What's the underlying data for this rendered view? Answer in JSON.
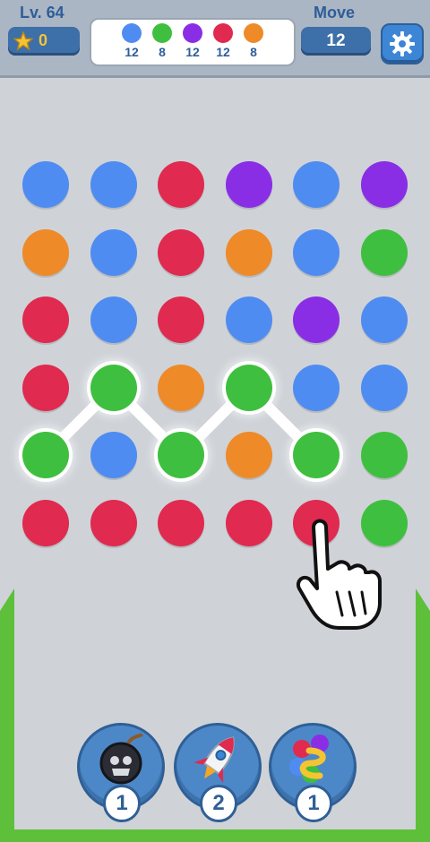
{
  "hud": {
    "level": "Lv. 64",
    "coins": "0",
    "move_label": "Move",
    "moves": "12",
    "goals": [
      {
        "color": "#4f8cf2",
        "count": "12"
      },
      {
        "color": "#3fbf3f",
        "count": "8"
      },
      {
        "color": "#8a2ee6",
        "count": "12"
      },
      {
        "color": "#e02a4f",
        "count": "12"
      },
      {
        "color": "#ef8a28",
        "count": "8"
      }
    ]
  },
  "colors": {
    "blue": "#4f8cf2",
    "red": "#e02a4f",
    "purple": "#8a2ee6",
    "orange": "#ef8a28",
    "green": "#3fbf3f"
  },
  "grid": [
    [
      "blue",
      "blue",
      "red",
      "purple",
      "blue",
      "purple"
    ],
    [
      "orange",
      "blue",
      "red",
      "orange",
      "blue",
      "green"
    ],
    [
      "red",
      "blue",
      "red",
      "blue",
      "purple",
      "blue"
    ],
    [
      "red",
      "green",
      "orange",
      "green",
      "blue",
      "blue"
    ],
    [
      "green",
      "blue",
      "green",
      "orange",
      "green",
      "green"
    ],
    [
      "red",
      "red",
      "red",
      "red",
      "red",
      "green"
    ]
  ],
  "selected_path": [
    [
      4,
      0
    ],
    [
      3,
      1
    ],
    [
      4,
      2
    ],
    [
      3,
      3
    ],
    [
      4,
      4
    ]
  ],
  "boosters": [
    {
      "name": "bomb",
      "icon": "bomb-icon",
      "count": "1"
    },
    {
      "name": "rocket",
      "icon": "rocket-icon",
      "count": "2"
    },
    {
      "name": "shuffle",
      "icon": "shuffle-icon",
      "count": "1"
    }
  ]
}
